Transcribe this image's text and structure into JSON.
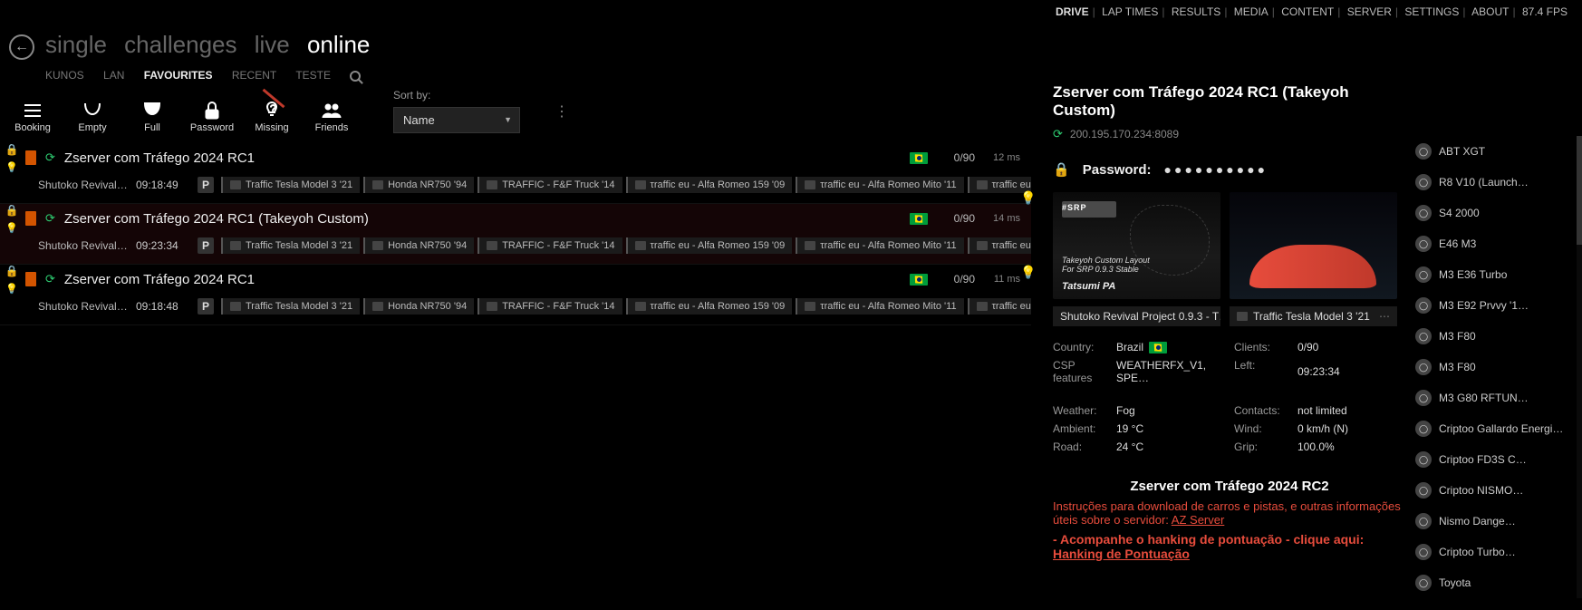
{
  "top_menu": {
    "items": [
      "DRIVE",
      "LAP TIMES",
      "RESULTS",
      "MEDIA",
      "CONTENT",
      "SERVER",
      "SETTINGS",
      "ABOUT"
    ],
    "active": "DRIVE",
    "fps": "87.4 FPS"
  },
  "modes": {
    "items": [
      "single",
      "challenges",
      "live",
      "online"
    ],
    "active": "online"
  },
  "subtabs": {
    "items": [
      "KUNOS",
      "LAN",
      "FAVOURITES",
      "RECENT",
      "TESTE"
    ],
    "active": "FAVOURITES"
  },
  "filters": {
    "buttons": [
      {
        "id": "booking",
        "label": "Booking"
      },
      {
        "id": "empty",
        "label": "Empty"
      },
      {
        "id": "full",
        "label": "Full"
      },
      {
        "id": "password",
        "label": "Password"
      },
      {
        "id": "missing",
        "label": "Missing"
      },
      {
        "id": "friends",
        "label": "Friends"
      }
    ],
    "sort_label": "Sort by:",
    "sort_value": "Name"
  },
  "car_chips": [
    "Traffic Tesla Model 3 '21",
    "Honda NR750 '94",
    "TRAFFIC - F&F Truck '14",
    "τraffic eu - Alfa Romeo 159 '09",
    "τraffic eu - Alfa Romeo Mito '11",
    "τraffic eu - Audi"
  ],
  "servers": [
    {
      "name": "Zserver com Tráfego 2024 RC1",
      "track": "Shutoko Revival Pr...",
      "time": "09:18:49",
      "p": true,
      "count": "0/90",
      "ping": "12 ms",
      "flag": "br"
    },
    {
      "name": "Zserver com Tráfego 2024 RC1 (Takeyoh Custom)",
      "track": "Shutoko Revival Pr...",
      "time": "09:23:34",
      "p": true,
      "count": "0/90",
      "ping": "14 ms",
      "flag": "br",
      "selected": true
    },
    {
      "name": "Zserver com Tráfego 2024 RC1",
      "track": "Shutoko Revival Pr...",
      "time": "09:18:48",
      "p": true,
      "count": "0/90",
      "ping": "11 ms",
      "flag": "br"
    }
  ],
  "details": {
    "title": "Zserver com Tráfego 2024 RC1 (Takeyoh Custom)",
    "address": "200.195.170.234:8089",
    "password_label": "Password:",
    "password_mask": "●●●●●●●●●●",
    "thumb_srp": "#SRP",
    "thumb_tak": "Takeyoh Custom Layout\nFor SRP 0.9.3 Stable",
    "thumb1_name": "Shutoko Revival Project 0.9.3 - T…",
    "thumb2_name": "Traffic Tesla Model 3 '21",
    "info": {
      "country_k": "Country:",
      "country_v": "Brazil",
      "csp_k": "CSP features",
      "csp_v": "WEATHERFX_V1, SPE…",
      "clients_k": "Clients:",
      "clients_v": "0/90",
      "left_k": "Left:",
      "left_v": "09:23:34",
      "weather_k": "Weather:",
      "weather_v": "Fog",
      "ambient_k": "Ambient:",
      "ambient_v": "19 °C",
      "road_k": "Road:",
      "road_v": "24 °C",
      "contacts_k": "Contacts:",
      "contacts_v": "not limited",
      "wind_k": "Wind:",
      "wind_v": "0 km/h (N)",
      "grip_k": "Grip:",
      "grip_v": "100.0%"
    },
    "desc_title": "Zserver com Tráfego 2024 RC2",
    "desc_line1": "Instruções para download de carros e pistas, e outras informações úteis sobre o servidor: ",
    "desc_link1": "AZ Server",
    "desc_bold1": "- Acompanhe o hanking de pontuação - clique aqui: ",
    "desc_link2": "Hanking de Pontuação"
  },
  "right_cars": [
    "ABT XGT",
    "R8 V10 (Launch…",
    "S4 2000",
    "E46 M3",
    "M3 E36 Turbo",
    "M3 E92 Prvvy '1…",
    "M3 F80",
    "M3 F80",
    "M3 G80 RFTUN…",
    "Criptoo Gallardo Energi…",
    "Criptoo FD3S C…",
    "Criptoo NISMO…",
    "Nismo Dange…",
    "Criptoo Turbo…",
    "Toyota"
  ]
}
